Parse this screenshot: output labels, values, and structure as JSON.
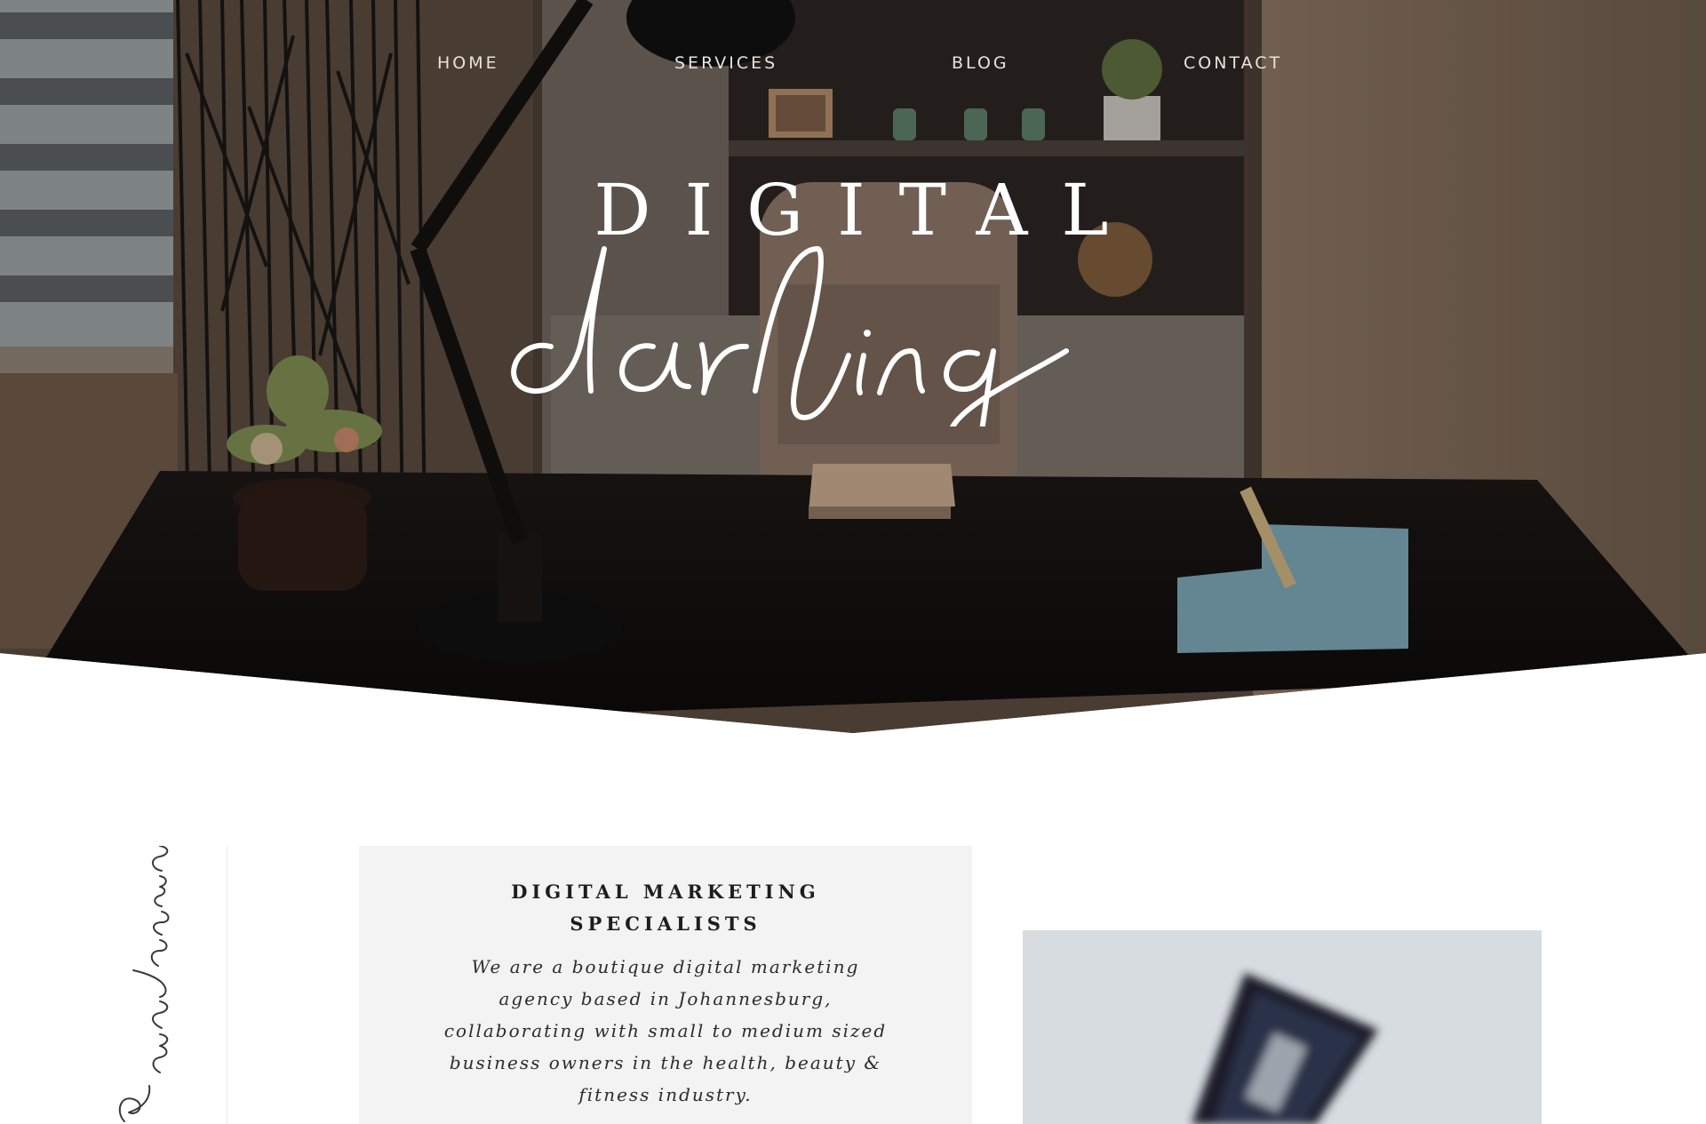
{
  "nav": {
    "items": [
      "HOME",
      "SERVICES",
      "BLOG",
      "CONTACT"
    ]
  },
  "logo": {
    "top_word": "DIGITAL",
    "script_word": "darling"
  },
  "welcome": {
    "script_text": "& welcome"
  },
  "intro": {
    "heading_line1": "DIGITAL MARKETING",
    "heading_line2": "SPECIALISTS",
    "body": "We are a boutique digital marketing agency based in Johannesburg, collaborating with small to medium sized business owners in the health, beauty & fitness industry."
  },
  "colors": {
    "nav_text": "#e8e2dc",
    "card_background": "#f3f3f3",
    "hero_overlay": "#2a221c"
  },
  "icons": {
    "hero_image": "home-office-desk-photo",
    "side_image": "phone-on-desk-photo"
  }
}
